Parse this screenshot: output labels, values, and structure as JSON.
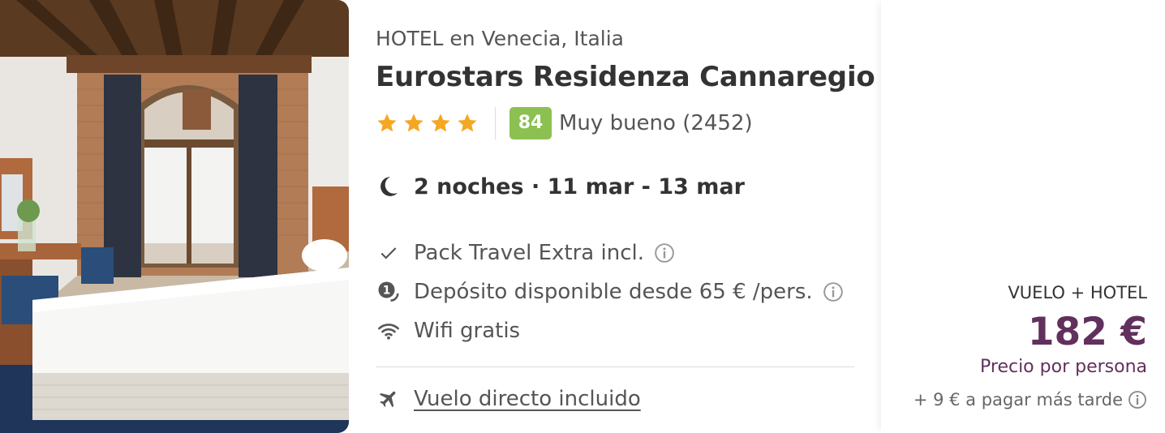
{
  "hotel": {
    "subtitle": "HOTEL en Venecia, Italia",
    "name": "Eurostars Residenza Cannaregio",
    "stars": 4,
    "score": "84",
    "score_text": "Muy bueno (2452)",
    "stay": "2 noches · 11 mar - 13 mar"
  },
  "features": [
    {
      "icon": "check-icon",
      "label": "Pack Travel Extra incl.",
      "info": true
    },
    {
      "icon": "deposit-icon",
      "label": "Depósito disponible desde 65 € /pers.",
      "info": true
    },
    {
      "icon": "wifi-icon",
      "label": "Wifi gratis",
      "info": false
    }
  ],
  "flight": {
    "icon": "plane-icon",
    "label": "Vuelo directo incluido"
  },
  "price": {
    "type": "VUELO + HOTEL",
    "amount": "182 €",
    "note": "Precio por persona",
    "later": "+ 9 € a pagar más tarde"
  },
  "colors": {
    "score_bg": "#8cc152",
    "star": "#f5a623",
    "price": "#62305d"
  }
}
